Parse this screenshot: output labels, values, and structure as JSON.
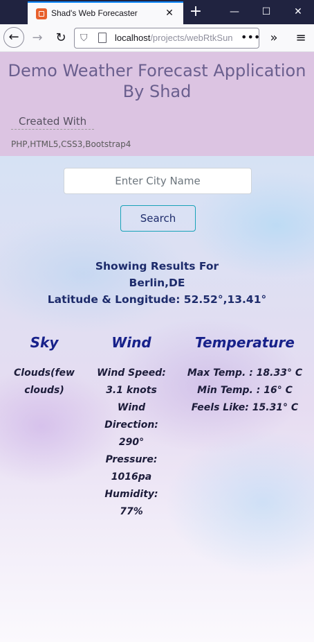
{
  "browser": {
    "tab_title": "Shad's Web Forecaster",
    "url_host": "localhost",
    "url_path": "/projects/webRtkSun"
  },
  "header": {
    "title": "Demo Weather Forecast Application By Shad",
    "created_with_label": "Created With",
    "tech_stack": "PHP,HTML5,CSS3,Bootstrap4"
  },
  "search": {
    "placeholder": "Enter City Name",
    "button_label": "Search"
  },
  "results": {
    "heading": "Showing Results For",
    "location": "Berlin,DE",
    "coordinates": "Latitude & Longitude: 52.52°,13.41°"
  },
  "sky": {
    "title": "Sky",
    "lines": [
      "Clouds(few",
      "clouds)"
    ]
  },
  "wind": {
    "title": "Wind",
    "lines": [
      "Wind Speed:",
      "3.1 knots",
      "Wind",
      "Direction:",
      "290°",
      "Pressure:",
      "1016pa",
      "Humidity:",
      "77%"
    ]
  },
  "temperature": {
    "title": "Temperature",
    "lines": [
      "Max Temp. : 18.33° C",
      "Min Temp. : 16° C",
      "Feels Like: 15.31° C"
    ]
  },
  "colors": {
    "header_bg": "#dcc4e2",
    "title_text": "#6a5f8e",
    "result_text": "#1d2b6b",
    "column_title": "#17218a",
    "button_border": "#17a2b8"
  }
}
